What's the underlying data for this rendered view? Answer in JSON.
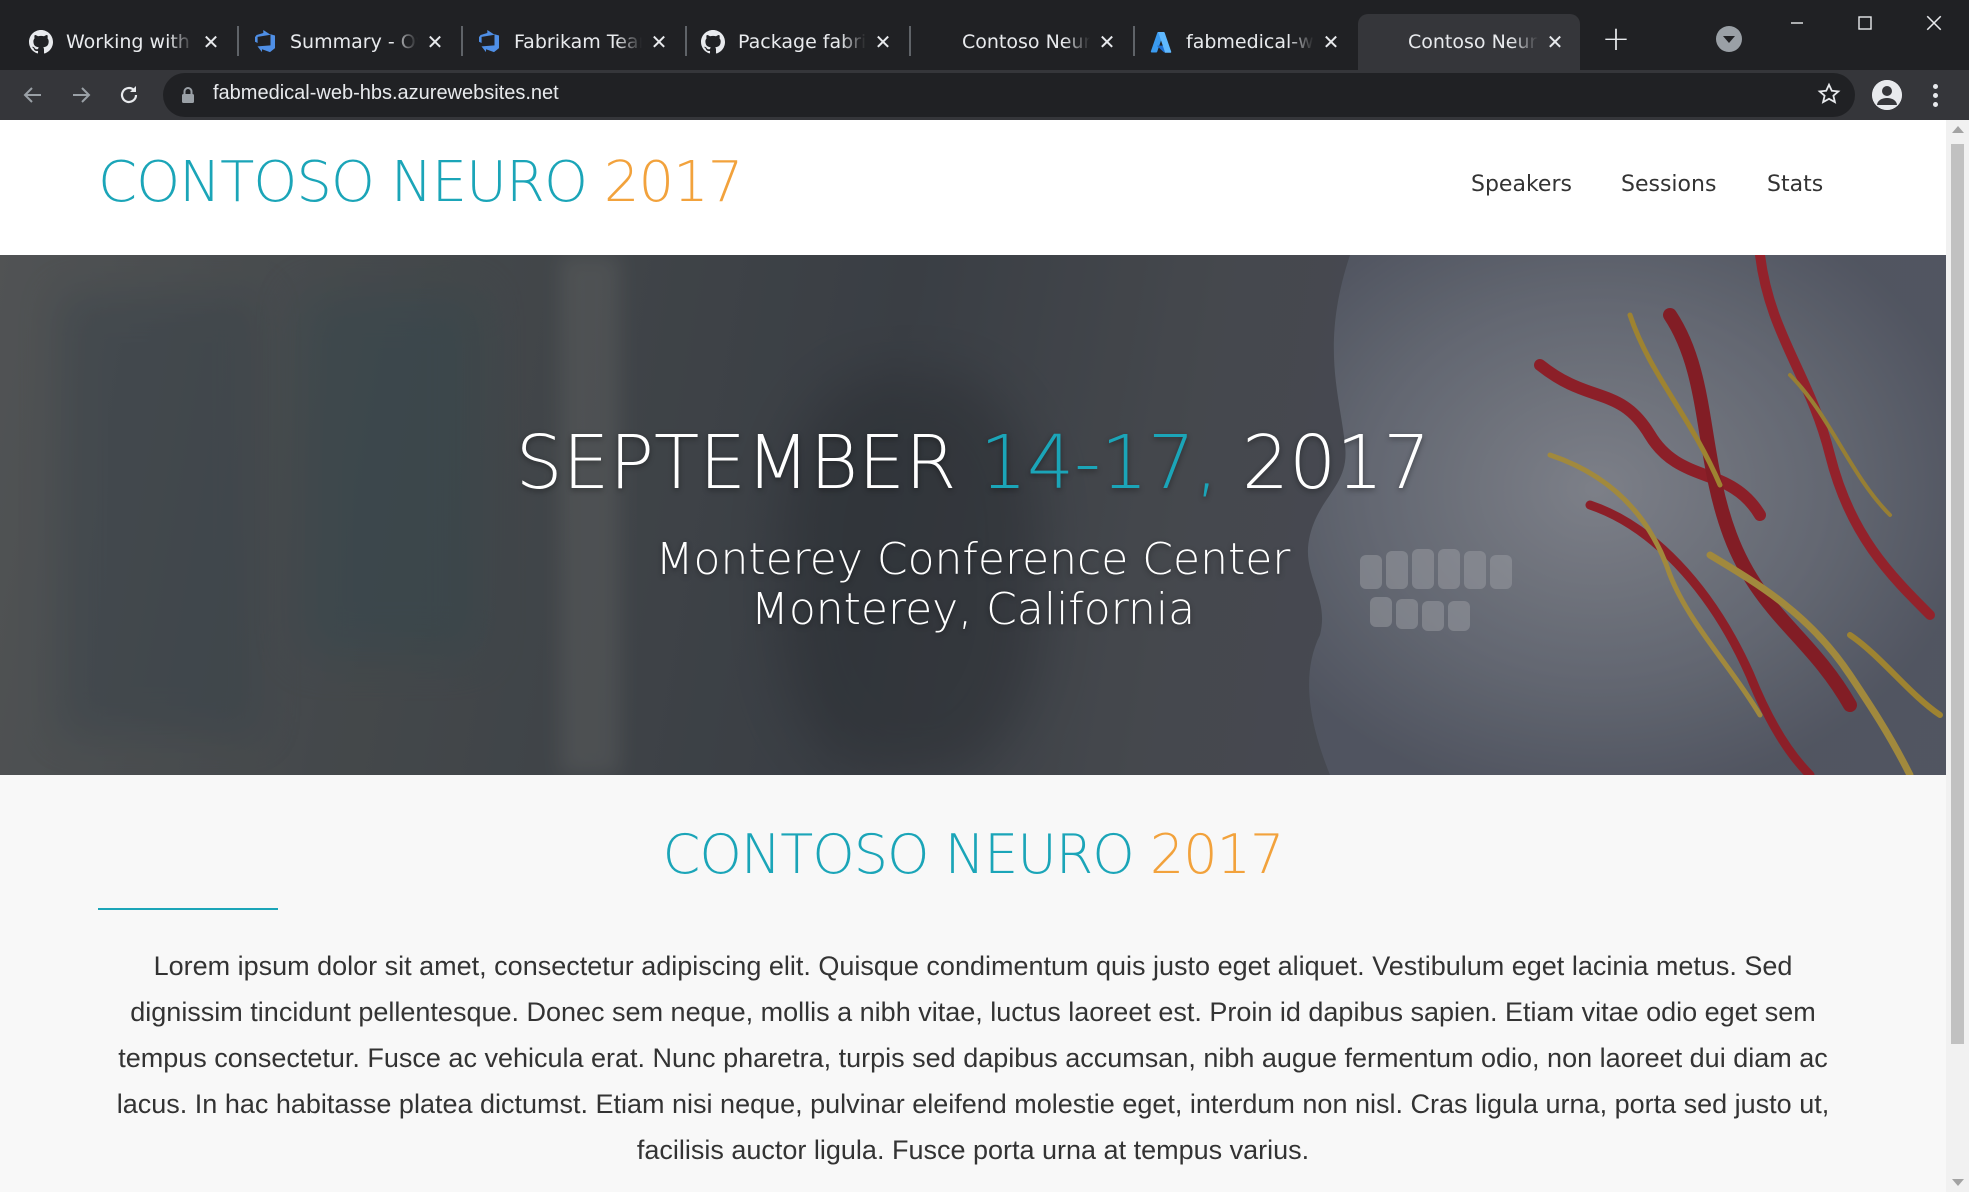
{
  "browser": {
    "tabs": [
      {
        "title": "Working with the",
        "icon": "github-icon"
      },
      {
        "title": "Summary - Overview",
        "icon": "azure-devops-icon"
      },
      {
        "title": "Fabrikam Team",
        "icon": "azure-devops-icon"
      },
      {
        "title": "Package fabrikam",
        "icon": "github-icon"
      },
      {
        "title": "Contoso Neuro",
        "icon": "none"
      },
      {
        "title": "fabmedical-web",
        "icon": "azure-icon"
      },
      {
        "title": "Contoso Neuro",
        "icon": "none"
      }
    ],
    "active_tab": 6,
    "url": "fabmedical-web-hbs.azurewebsites.net"
  },
  "site": {
    "logo": {
      "brand": "CONTOSO NEURO ",
      "year": "2017"
    },
    "nav": [
      "Speakers",
      "Sessions",
      "Stats"
    ],
    "hero": {
      "date_month": "SEPTEMBER ",
      "date_days": "14-17, ",
      "date_year": "2017",
      "venue_line1": "Monterey Conference Center",
      "venue_line2": "Monterey, California"
    },
    "about": {
      "title_brand": "CONTOSO NEURO ",
      "title_year": "2017",
      "text": "Lorem ipsum dolor sit amet, consectetur adipiscing elit. Quisque condimentum quis justo eget aliquet. Vestibulum eget lacinia metus. Sed dignissim tincidunt pellentesque. Donec sem neque, mollis a nibh vitae, luctus laoreet est. Proin id dapibus sapien. Etiam vitae odio eget sem tempus consectetur. Fusce ac vehicula erat. Nunc pharetra, turpis sed dapibus accumsan, nibh augue fermentum odio, non laoreet dui diam ac lacus. In hac habitasse platea dictumst. Etiam nisi neque, pulvinar eleifend molestie eget, interdum non nisl. Cras ligula urna, porta sed justo ut, facilisis auctor ligula. Fusce porta urna at tempus varius."
    }
  },
  "colors": {
    "teal": "#1ba5b8",
    "orange": "#f2a23c",
    "chrome_dark": "#202124",
    "chrome_mid": "#35363a"
  }
}
